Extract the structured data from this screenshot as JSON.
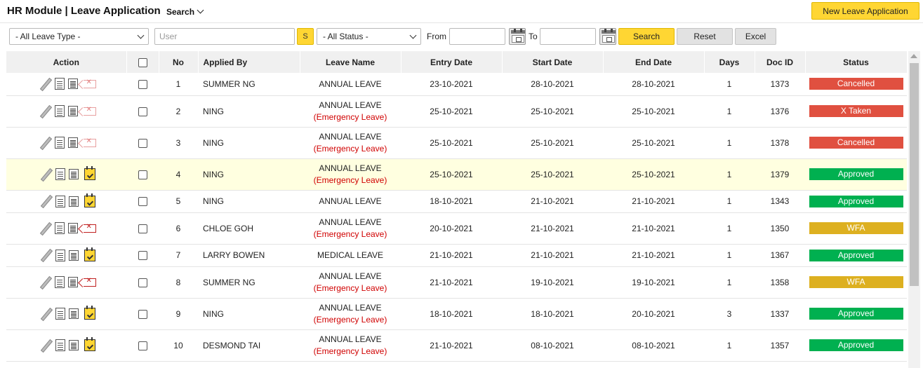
{
  "header": {
    "title": "HR Module | Leave Application",
    "search_toggle": "Search",
    "new_button": "New Leave Application"
  },
  "filters": {
    "leave_type": "- All Leave Type -",
    "user_placeholder": "User",
    "s_button": "S",
    "status": "- All Status -",
    "from_label": "From",
    "to_label": "To",
    "search_button": "Search",
    "reset_button": "Reset",
    "excel_button": "Excel"
  },
  "table": {
    "columns": {
      "action": "Action",
      "no": "No",
      "applied_by": "Applied By",
      "leave_name": "Leave Name",
      "entry_date": "Entry Date",
      "start_date": "Start Date",
      "end_date": "End Date",
      "days": "Days",
      "doc_id": "Doc ID",
      "status": "Status"
    },
    "rows": [
      {
        "no": "1",
        "applied_by": "SUMMER NG",
        "leave_name": "ANNUAL LEAVE",
        "note": "",
        "entry_date": "23-10-2021",
        "start_date": "28-10-2021",
        "end_date": "28-10-2021",
        "days": "1",
        "doc_id": "1373",
        "status": "Cancelled",
        "status_color": "#e05040",
        "last_icon": "delete-icon",
        "highlight": false
      },
      {
        "no": "2",
        "applied_by": "NING",
        "leave_name": "ANNUAL LEAVE",
        "note": "(Emergency Leave)",
        "entry_date": "25-10-2021",
        "start_date": "25-10-2021",
        "end_date": "25-10-2021",
        "days": "1",
        "doc_id": "1376",
        "status": "X Taken",
        "status_color": "#e05040",
        "last_icon": "delete-icon",
        "highlight": false
      },
      {
        "no": "3",
        "applied_by": "NING",
        "leave_name": "ANNUAL LEAVE",
        "note": "(Emergency Leave)",
        "entry_date": "25-10-2021",
        "start_date": "25-10-2021",
        "end_date": "25-10-2021",
        "days": "1",
        "doc_id": "1378",
        "status": "Cancelled",
        "status_color": "#e05040",
        "last_icon": "delete-icon",
        "highlight": false
      },
      {
        "no": "4",
        "applied_by": "NING",
        "leave_name": "ANNUAL LEAVE",
        "note": "(Emergency Leave)",
        "entry_date": "25-10-2021",
        "start_date": "25-10-2021",
        "end_date": "25-10-2021",
        "days": "1",
        "doc_id": "1379",
        "status": "Approved",
        "status_color": "#00b050",
        "last_icon": "calendar-check-icon",
        "highlight": true
      },
      {
        "no": "5",
        "applied_by": "NING",
        "leave_name": "ANNUAL LEAVE",
        "note": "",
        "entry_date": "18-10-2021",
        "start_date": "21-10-2021",
        "end_date": "21-10-2021",
        "days": "1",
        "doc_id": "1343",
        "status": "Approved",
        "status_color": "#00b050",
        "last_icon": "calendar-check-icon",
        "highlight": false
      },
      {
        "no": "6",
        "applied_by": "CHLOE GOH",
        "leave_name": "ANNUAL LEAVE",
        "note": "(Emergency Leave)",
        "entry_date": "20-10-2021",
        "start_date": "21-10-2021",
        "end_date": "21-10-2021",
        "days": "1",
        "doc_id": "1350",
        "status": "WFA",
        "status_color": "#ddb020",
        "last_icon": "delete-icon-active",
        "highlight": false
      },
      {
        "no": "7",
        "applied_by": "LARRY BOWEN",
        "leave_name": "MEDICAL LEAVE",
        "note": "",
        "entry_date": "21-10-2021",
        "start_date": "21-10-2021",
        "end_date": "21-10-2021",
        "days": "1",
        "doc_id": "1367",
        "status": "Approved",
        "status_color": "#00b050",
        "last_icon": "calendar-check-icon",
        "highlight": false
      },
      {
        "no": "8",
        "applied_by": "SUMMER NG",
        "leave_name": "ANNUAL LEAVE",
        "note": "(Emergency Leave)",
        "entry_date": "21-10-2021",
        "start_date": "19-10-2021",
        "end_date": "19-10-2021",
        "days": "1",
        "doc_id": "1358",
        "status": "WFA",
        "status_color": "#ddb020",
        "last_icon": "delete-icon-active",
        "highlight": false
      },
      {
        "no": "9",
        "applied_by": "NING",
        "leave_name": "ANNUAL LEAVE",
        "note": "(Emergency Leave)",
        "entry_date": "18-10-2021",
        "start_date": "18-10-2021",
        "end_date": "20-10-2021",
        "days": "3",
        "doc_id": "1337",
        "status": "Approved",
        "status_color": "#00b050",
        "last_icon": "calendar-check-icon",
        "highlight": false
      },
      {
        "no": "10",
        "applied_by": "DESMOND TAI",
        "leave_name": "ANNUAL LEAVE",
        "note": "(Emergency Leave)",
        "entry_date": "21-10-2021",
        "start_date": "08-10-2021",
        "end_date": "08-10-2021",
        "days": "1",
        "doc_id": "1357",
        "status": "Approved",
        "status_color": "#00b050",
        "last_icon": "calendar-check-icon",
        "highlight": false
      }
    ]
  }
}
